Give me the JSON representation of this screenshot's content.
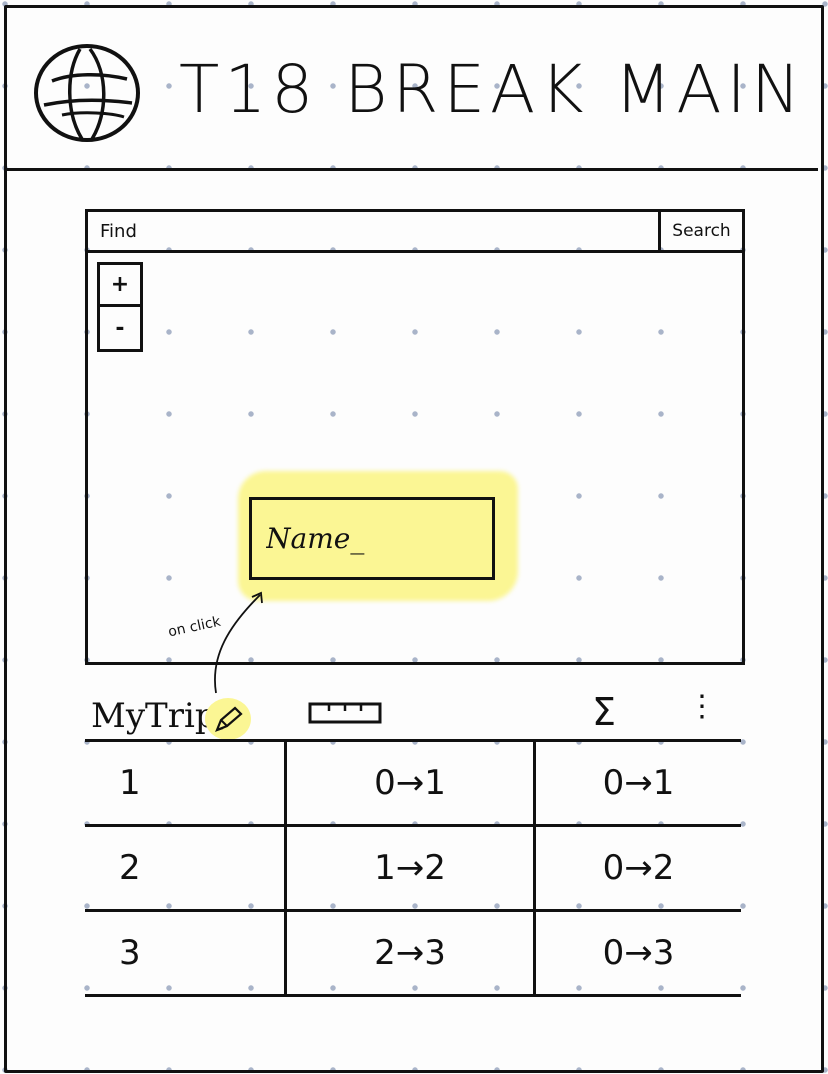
{
  "header": {
    "title": "T18 BREAK MAIN",
    "logo_icon": "globe-icon"
  },
  "map": {
    "search": {
      "placeholder": "Find",
      "button_label": "Search"
    },
    "zoom": {
      "in_label": "+",
      "out_label": "-"
    },
    "name_popup": {
      "placeholder": "Name_"
    },
    "annotation": "on click"
  },
  "toolbar": {
    "trip_title": "MyTrip",
    "edit_icon": "pencil-icon",
    "distance_icon": "ruler-icon",
    "total_label": "Σ",
    "more_label": "⋮",
    "highlight_color": "#fbf694"
  },
  "legs": [
    {
      "place": "1",
      "leg": "0→1",
      "cumulative": "0→1"
    },
    {
      "place": "2",
      "leg": "1→2",
      "cumulative": "0→2"
    },
    {
      "place": "3",
      "leg": "2→3",
      "cumulative": "0→3"
    }
  ]
}
